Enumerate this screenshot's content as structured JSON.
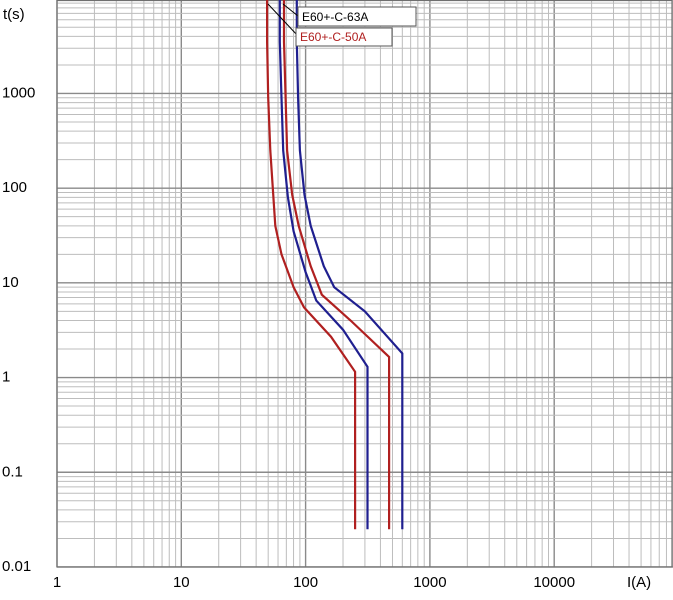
{
  "chart_data": {
    "type": "line",
    "xlabel": "I(A)",
    "ylabel": "t(s)",
    "xscale": "log",
    "yscale": "log",
    "xlim": [
      1,
      20000
    ],
    "ylim": [
      0.01,
      10000
    ],
    "grid": true,
    "x_ticks": [
      "1",
      "10",
      "100",
      "1000",
      "10000"
    ],
    "y_ticks": [
      "0.01",
      "0.1",
      "1",
      "10",
      "100",
      "1000"
    ],
    "series": [
      {
        "name": "E60+-C-63A",
        "color": "#1f1f8f",
        "label_color": "#000000",
        "curves": [
          {
            "x": [
              62,
              62,
              64,
              66,
              72,
              80,
              100,
              122,
              200,
              315,
              315,
              315
            ],
            "y": [
              10000,
              3500,
              900,
              250,
              80,
              35,
              13,
              6.5,
              3.2,
              1.3,
              0.5,
              0.025
            ]
          },
          {
            "x": [
              85,
              85,
              87,
              90,
              98,
              110,
              140,
              170,
              300,
              600,
              600,
              600
            ],
            "y": [
              10000,
              3500,
              900,
              250,
              85,
              40,
              15,
              9,
              5,
              1.8,
              0.5,
              0.025
            ]
          }
        ]
      },
      {
        "name": "E60+-C-50A",
        "color": "#b02020",
        "label_color": "#b02020",
        "curves": [
          {
            "x": [
              49,
              49,
              50,
              52,
              57,
              64,
              80,
              97,
              160,
              250,
              250,
              250
            ],
            "y": [
              10000,
              3500,
              900,
              250,
              40,
              20,
              9,
              5.5,
              2.7,
              1.15,
              0.5,
              0.025
            ]
          },
          {
            "x": [
              67,
              67,
              69,
              71,
              78,
              88,
              110,
              135,
              230,
              470,
              470,
              470
            ],
            "y": [
              10000,
              3500,
              900,
              250,
              85,
              40,
              15,
              7.5,
              4,
              1.65,
              0.5,
              0.025
            ]
          }
        ]
      }
    ]
  }
}
